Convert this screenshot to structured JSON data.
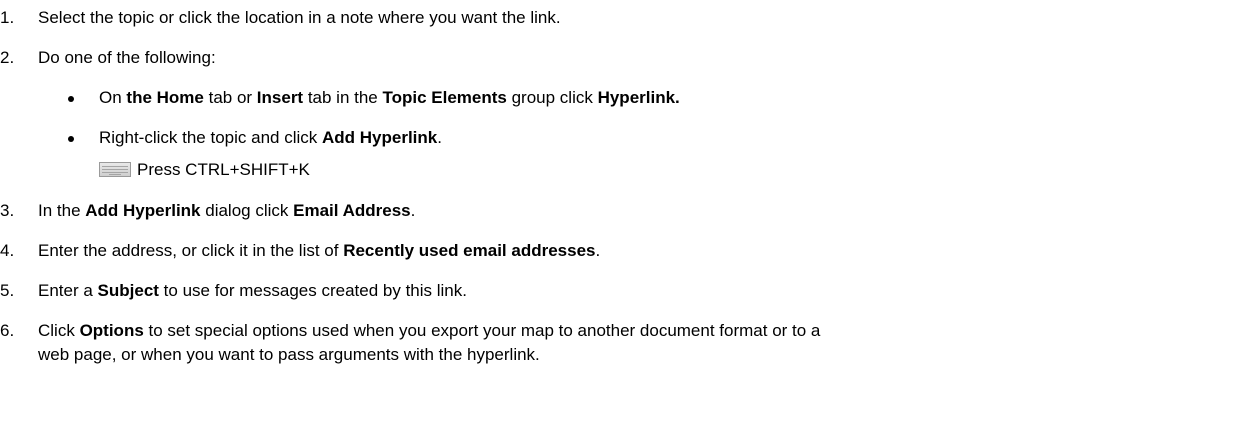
{
  "steps": [
    {
      "num": "1.",
      "parts": [
        {
          "t": "Select the topic or click the location in a note where you want the link."
        }
      ]
    },
    {
      "num": "2.",
      "parts": [
        {
          "t": "Do one of the following:"
        }
      ]
    },
    {
      "num": "3.",
      "parts": [
        {
          "t": "In the "
        },
        {
          "t": "Add Hyperlink",
          "b": true
        },
        {
          "t": " dialog click "
        },
        {
          "t": "Email Address",
          "b": true
        },
        {
          "t": "."
        }
      ]
    },
    {
      "num": "4.",
      "parts": [
        {
          "t": "Enter the address, or click it in the list of "
        },
        {
          "t": "Recently used email addresses",
          "b": true
        },
        {
          "t": "."
        }
      ]
    },
    {
      "num": "5.",
      "parts": [
        {
          "t": "Enter a "
        },
        {
          "t": "Subject",
          "b": true
        },
        {
          "t": " to use for messages created by this link."
        }
      ]
    },
    {
      "num": "6.",
      "parts": [
        {
          "t": "Click "
        },
        {
          "t": "Options",
          "b": true
        },
        {
          "t": " to set special options used when you export your map to another document format or to a"
        }
      ],
      "continuation": "web page, or when you want to pass arguments with the hyperlink."
    }
  ],
  "bullets": [
    {
      "parts": [
        {
          "t": "On "
        },
        {
          "t": "the Home",
          "b": true
        },
        {
          "t": " tab or "
        },
        {
          "t": "Insert",
          "b": true
        },
        {
          "t": " tab in the "
        },
        {
          "t": "Topic Elements",
          "b": true
        },
        {
          "t": " group click "
        },
        {
          "t": "Hyperlink.",
          "b": true
        }
      ]
    },
    {
      "parts": [
        {
          "t": "Right-click the topic and click "
        },
        {
          "t": "Add Hyperlink",
          "b": true
        },
        {
          "t": "."
        }
      ]
    }
  ],
  "shortcut": {
    "icon": "keyboard-icon",
    "text": "Press CTRL+SHIFT+K"
  }
}
